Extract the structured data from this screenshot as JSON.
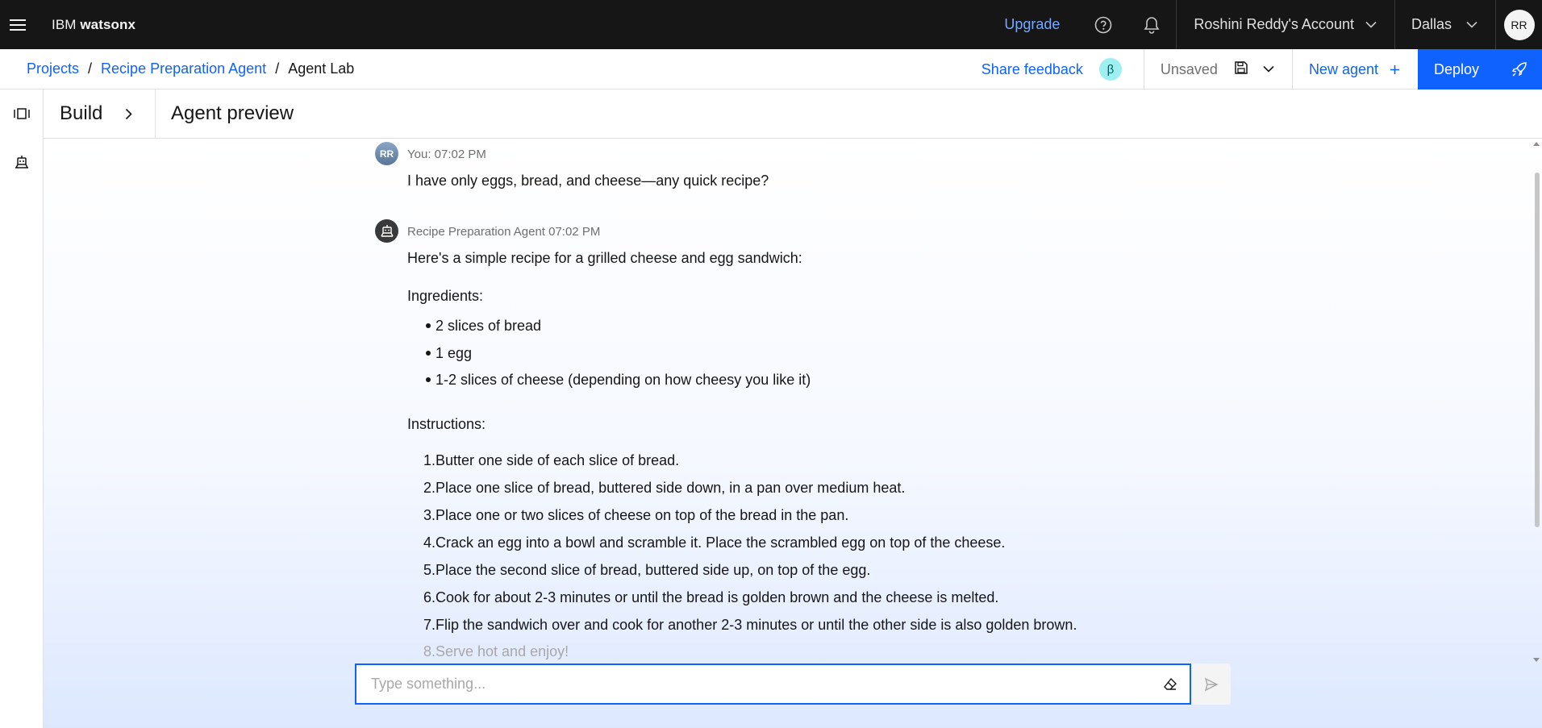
{
  "header": {
    "brand_prefix": "IBM",
    "brand_name": "watsonx",
    "upgrade_label": "Upgrade",
    "account_label": "Roshini Reddy's Account",
    "region_label": "Dallas",
    "avatar_initials": "RR"
  },
  "breadcrumb": {
    "items": [
      "Projects",
      "Recipe Preparation Agent",
      "Agent Lab"
    ],
    "separator": "/"
  },
  "actions": {
    "share_feedback": "Share feedback",
    "beta_badge": "β",
    "save_status": "Unsaved",
    "new_agent": "New agent",
    "deploy": "Deploy"
  },
  "panel": {
    "build_label": "Build",
    "preview_title": "Agent preview"
  },
  "conversation": {
    "user": {
      "avatar_initials": "RR",
      "meta": "You: 07:02 PM",
      "text": "I have only eggs, bread, and cheese—any quick recipe?"
    },
    "agent": {
      "meta": "Recipe Preparation Agent 07:02 PM",
      "intro": "Here's a simple recipe for a grilled cheese and egg sandwich:",
      "ingredients_heading": "Ingredients:",
      "ingredients": [
        "2 slices of bread",
        "1 egg",
        "1-2 slices of cheese (depending on how cheesy you like it)"
      ],
      "instructions_heading": "Instructions:",
      "instructions": [
        "Butter one side of each slice of bread.",
        "Place one slice of bread, buttered side down, in a pan over medium heat.",
        "Place one or two slices of cheese on top of the bread in the pan.",
        "Crack an egg into a bowl and scramble it. Place the scrambled egg on top of the cheese.",
        "Place the second slice of bread, buttered side up, on top of the egg.",
        "Cook for about 2-3 minutes or until the bread is golden brown and the cheese is melted.",
        "Flip the sandwich over and cook for another 2-3 minutes or until the other side is also golden brown.",
        "Serve hot and enjoy!"
      ]
    }
  },
  "chat_input": {
    "placeholder": "Type something...",
    "value": ""
  },
  "colors": {
    "header_bg": "#161616",
    "link_blue": "#0f62fe",
    "upgrade_blue": "#78a9ff",
    "deploy_bg": "#0f62fe",
    "beta_bg": "#9ef0f0"
  },
  "icons": {
    "menu": "hamburger-icon",
    "help": "help-icon",
    "notifications": "bell-icon",
    "save": "floppy-disk-icon",
    "deploy": "rocket-icon",
    "clear": "eraser-icon",
    "send": "send-icon"
  }
}
